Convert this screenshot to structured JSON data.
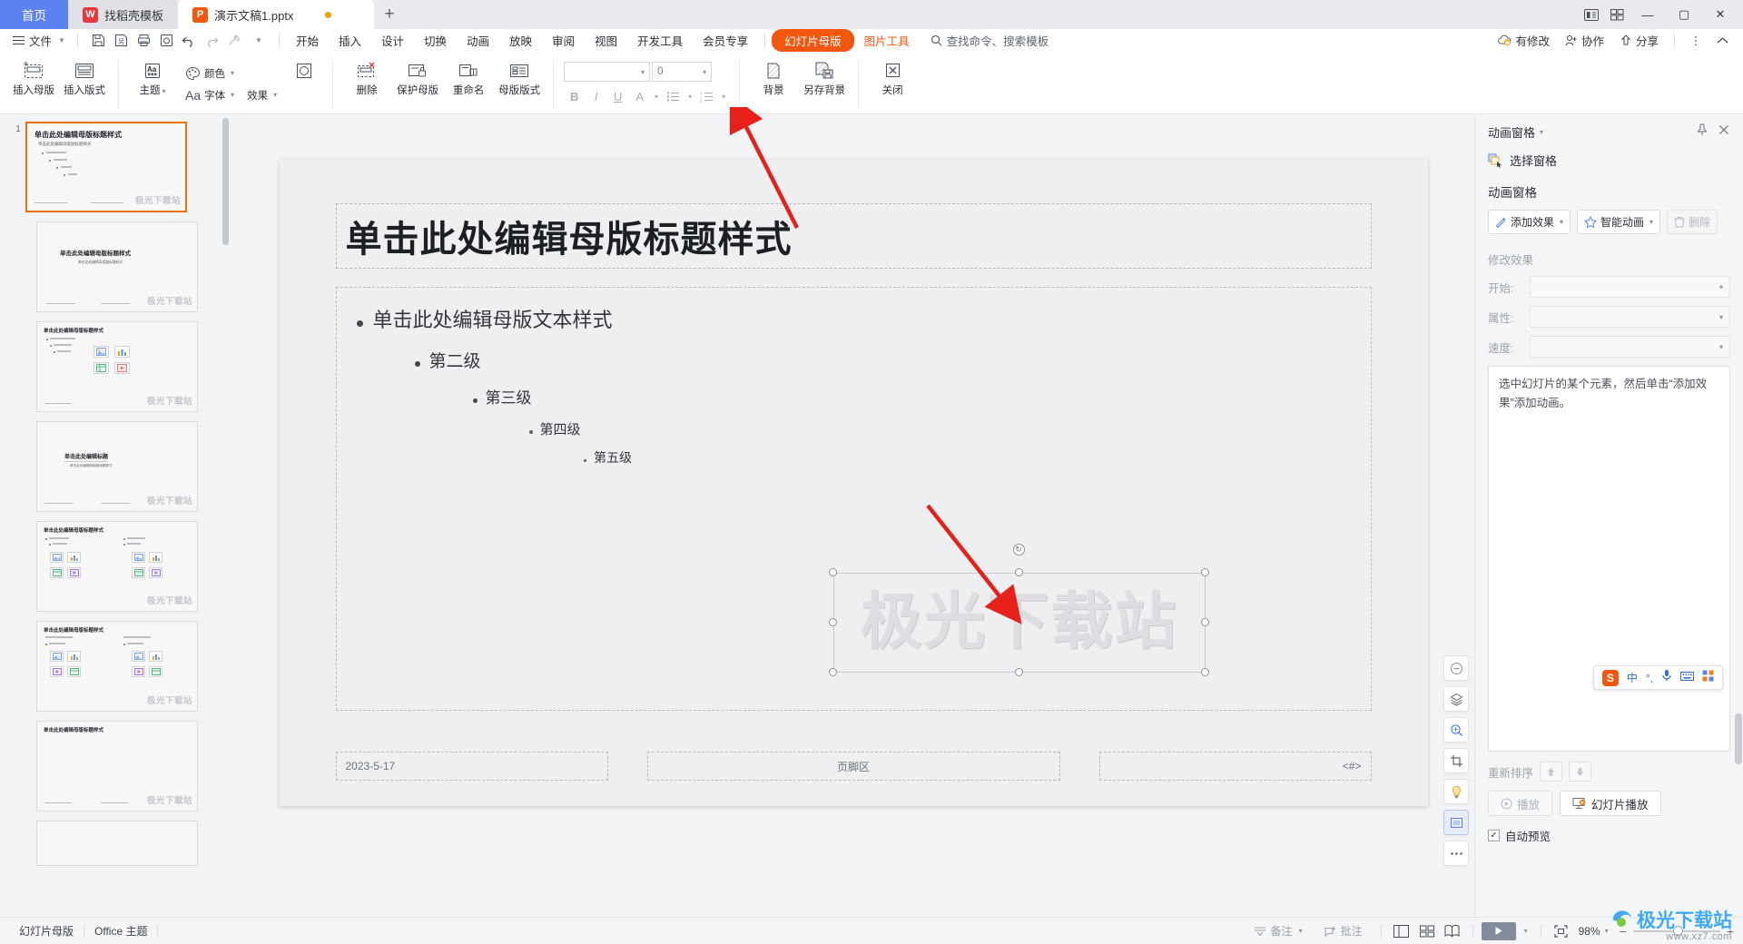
{
  "window": {
    "tabs": [
      {
        "id": "home",
        "label": "首页",
        "type": "home"
      },
      {
        "id": "template",
        "label": "找稻壳模板",
        "icon": "docer-icon",
        "icon_color": "#e8373d",
        "type": "inactive"
      },
      {
        "id": "doc1",
        "label": "演示文稿1.pptx",
        "icon": "ppt-icon",
        "icon_color": "#f2570f",
        "type": "active",
        "modified": true
      }
    ],
    "new_tab_label": "+",
    "right_buttons": [
      "tab-list-icon",
      "grid-view-icon"
    ],
    "controls": {
      "minimize": "—",
      "maximize": "▢",
      "close": "✕"
    }
  },
  "menubar": {
    "file_label": "文件",
    "quick_access": [
      "save-icon",
      "save-as-icon",
      "print-icon",
      "print-preview-icon",
      "undo-icon",
      "redo-icon",
      "format-painter-icon",
      "more-qat-icon"
    ],
    "items": [
      {
        "label": "开始",
        "style": "normal"
      },
      {
        "label": "插入",
        "style": "normal"
      },
      {
        "label": "设计",
        "style": "normal"
      },
      {
        "label": "切换",
        "style": "normal"
      },
      {
        "label": "动画",
        "style": "normal"
      },
      {
        "label": "放映",
        "style": "normal"
      },
      {
        "label": "审阅",
        "style": "normal"
      },
      {
        "label": "视图",
        "style": "normal"
      },
      {
        "label": "开发工具",
        "style": "normal"
      },
      {
        "label": "会员专享",
        "style": "normal"
      },
      {
        "label": "幻灯片母版",
        "style": "pill"
      },
      {
        "label": "图片工具",
        "style": "orange"
      }
    ],
    "search_placeholder": "查找命令、搜索模板",
    "right": [
      {
        "label": "有修改",
        "icon": "cloud-sync-icon"
      },
      {
        "label": "协作",
        "icon": "collaborate-icon"
      },
      {
        "label": "分享",
        "icon": "share-icon"
      }
    ],
    "more_icon": "more-vertical-icon",
    "collapse_icon": "chevron-up-icon"
  },
  "ribbon": {
    "groups": [
      {
        "name": "master-group",
        "buttons": [
          {
            "label": "插入母版",
            "icon": "insert-master-icon"
          },
          {
            "label": "插入版式",
            "icon": "insert-layout-icon"
          }
        ]
      },
      {
        "name": "theme-group",
        "buttons": [
          {
            "label": "主题",
            "icon": "theme-icon",
            "dropdown": true
          },
          {
            "label": "颜色",
            "icon": "color-palette-icon",
            "dropdown": true
          },
          {
            "label": "字体",
            "icon": "font-icon",
            "dropdown": true
          },
          {
            "label": "效果",
            "icon": "effects-icon",
            "dropdown": true
          }
        ]
      },
      {
        "name": "edit-group",
        "buttons": [
          {
            "label": "删除",
            "icon": "delete-master-icon"
          },
          {
            "label": "保护母版",
            "icon": "protect-master-icon"
          },
          {
            "label": "重命名",
            "icon": "rename-icon"
          },
          {
            "label": "母版版式",
            "icon": "master-layout-icon"
          }
        ]
      },
      {
        "name": "font-group",
        "font_name": "",
        "font_size": "0",
        "format_buttons": [
          "bold-icon",
          "italic-icon",
          "underline-icon",
          "font-color-icon",
          "bullets-icon",
          "numbering-icon"
        ]
      },
      {
        "name": "background-group",
        "buttons": [
          {
            "label": "背景",
            "icon": "background-icon"
          },
          {
            "label": "另存背景",
            "icon": "save-background-icon"
          }
        ]
      },
      {
        "name": "close-group",
        "buttons": [
          {
            "label": "关闭",
            "icon": "close-master-view-icon"
          }
        ]
      }
    ]
  },
  "thumbnails": {
    "selected_index": 0,
    "items": [
      {
        "number": "1",
        "title": "单击此处编辑母版标题样式",
        "subtitle": "单击此处编辑母版副标题样式",
        "kind": "master",
        "watermark": "极光下载站",
        "indent": false
      },
      {
        "number": "",
        "title": "单击此处编辑母版标题样式",
        "subtitle": "单击此处编辑母版副标题样式",
        "kind": "title-layout",
        "watermark": "极光下载站",
        "indent": true
      },
      {
        "number": "",
        "title": "单击此处编辑母版标题样式",
        "subtitle": "",
        "kind": "content-chart",
        "watermark": "极光下载站",
        "indent": true
      },
      {
        "number": "",
        "title": "单击此处编辑标题",
        "subtitle": "单击此处编辑母版副标题样式",
        "kind": "section",
        "watermark": "极光下载站",
        "indent": true
      },
      {
        "number": "",
        "title": "单击此处编辑母版标题样式",
        "subtitle": "",
        "kind": "two-content",
        "watermark": "极光下载站",
        "indent": true
      },
      {
        "number": "",
        "title": "单击此处编辑母版标题样式",
        "subtitle": "",
        "kind": "comparison",
        "watermark": "极光下载站",
        "indent": true
      },
      {
        "number": "",
        "title": "单击此处编辑母版标题样式",
        "subtitle": "",
        "kind": "title-only",
        "watermark": "极光下载站",
        "indent": true
      },
      {
        "number": "",
        "title": "",
        "subtitle": "",
        "kind": "blank",
        "watermark": "",
        "indent": true
      }
    ]
  },
  "slide": {
    "title_placeholder": "单击此处编辑母版标题样式",
    "body_levels": [
      "单击此处编辑母版文本样式",
      "第二级",
      "第三级",
      "第四级",
      "第五级"
    ],
    "date_placeholder": "2023-5-17",
    "footer_placeholder": "页脚区",
    "slide_number_placeholder": "<#>",
    "watermark_object": "极光下载站"
  },
  "canvas_tools": [
    {
      "icon": "minus-circle-icon",
      "name": "reduce-icon"
    },
    {
      "icon": "layers-icon",
      "name": "layers-icon"
    },
    {
      "icon": "zoom-icon",
      "name": "zoom-icon"
    },
    {
      "icon": "crop-icon",
      "name": "crop-icon"
    },
    {
      "icon": "bulb-icon",
      "name": "smart-tips-icon"
    },
    {
      "icon": "fit-icon",
      "name": "fit-page-icon"
    },
    {
      "icon": "more-dots-icon",
      "name": "more-tools-icon"
    }
  ],
  "animation_pane": {
    "title": "动画窗格",
    "pin_icon": "pin-icon",
    "close_icon": "close-icon",
    "select_pane_label": "选择窗格",
    "section_label": "动画窗格",
    "buttons": [
      {
        "label": "添加效果",
        "icon": "add-effect-icon",
        "dropdown": true,
        "disabled": false
      },
      {
        "label": "智能动画",
        "icon": "smart-animation-icon",
        "dropdown": true,
        "disabled": false
      },
      {
        "label": "删除",
        "icon": "trash-icon",
        "dropdown": false,
        "disabled": true
      }
    ],
    "modify_label": "修改效果",
    "fields": [
      {
        "label": "开始:",
        "value": ""
      },
      {
        "label": "属性:",
        "value": ""
      },
      {
        "label": "速度:",
        "value": ""
      }
    ],
    "hint_text": "选中幻灯片的某个元素，然后单击“添加效果”添加动画。",
    "reorder_label": "重新排序",
    "reorder_up_icon": "arrow-up-icon",
    "reorder_down_icon": "arrow-down-icon",
    "play_label": "播放",
    "slideshow_label": "幻灯片播放",
    "autopreview_label": "自动预览",
    "autopreview_checked": true
  },
  "statusbar": {
    "left_items": [
      "幻灯片母版",
      "Office 主题"
    ],
    "notes_label": "备注",
    "comment_label": "批注",
    "view_buttons": [
      "normal-view-icon",
      "slide-sorter-icon",
      "reading-view-icon"
    ],
    "play_icon": "play-icon",
    "fit_icon": "fit-to-window-icon",
    "zoom_value": "98%",
    "zoom_minus": "−",
    "zoom_plus": "+"
  },
  "ime_bar": {
    "logo": "S",
    "items": [
      "中",
      "°,",
      "mic-icon",
      "keyboard-icon",
      "apps-icon"
    ]
  },
  "site_watermark": {
    "title": "极光下载站",
    "url": "www.xz7.com"
  }
}
